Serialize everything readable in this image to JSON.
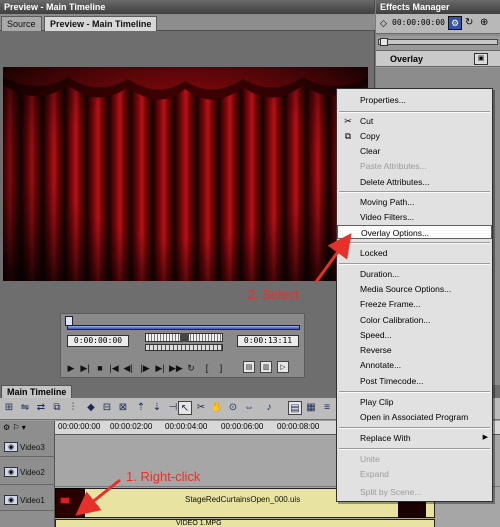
{
  "preview_panel": {
    "title": "Preview - Main Timeline",
    "tabs": [
      {
        "label": "Source"
      },
      {
        "label": "Preview - Main Timeline"
      }
    ],
    "timecode_in": "0:00:00:00",
    "timecode_out": "0:00:13:11",
    "position_fraction": 0.0
  },
  "effects_panel": {
    "title": "Effects Manager",
    "timecode": "00:00:00:00",
    "selected_effect": "Overlay"
  },
  "timeline": {
    "tab_label": "Main Timeline",
    "ruler_ticks": [
      "00:00:00:00",
      "00:00:02:00",
      "00:00:04:00",
      "00:00:06:00",
      "00:00:08:00"
    ],
    "tracks": [
      {
        "name": "Video3"
      },
      {
        "name": "Video2"
      },
      {
        "name": "Video1"
      }
    ],
    "clips": {
      "video2": "StageRedCurtainsOpen_000.uis",
      "video1": "VIDEO 1.MPG"
    }
  },
  "context_menu": {
    "items": [
      {
        "label": "Properties...",
        "enabled": true
      },
      {
        "label": "Cut",
        "enabled": true,
        "icon": "scissors-icon"
      },
      {
        "label": "Copy",
        "enabled": true,
        "icon": "copy-icon"
      },
      {
        "label": "Clear",
        "enabled": true
      },
      {
        "label": "Paste Attributes...",
        "enabled": false
      },
      {
        "label": "Delete Attributes...",
        "enabled": true
      },
      {
        "label": "Moving Path...",
        "enabled": true
      },
      {
        "label": "Video Filters...",
        "enabled": true
      },
      {
        "label": "Overlay Options...",
        "enabled": true,
        "highlighted": true
      },
      {
        "label": "Locked",
        "enabled": true
      },
      {
        "label": "Duration...",
        "enabled": true
      },
      {
        "label": "Media Source Options...",
        "enabled": true
      },
      {
        "label": "Freeze Frame...",
        "enabled": true
      },
      {
        "label": "Color Calibration...",
        "enabled": true
      },
      {
        "label": "Speed...",
        "enabled": true
      },
      {
        "label": "Reverse",
        "enabled": true
      },
      {
        "label": "Annotate...",
        "enabled": true
      },
      {
        "label": "Post Timecode...",
        "enabled": true
      },
      {
        "label": "Play Clip",
        "enabled": true
      },
      {
        "label": "Open in Associated Program",
        "enabled": true
      },
      {
        "label": "Replace With",
        "enabled": true,
        "submenu": true
      },
      {
        "label": "Unite",
        "enabled": false
      },
      {
        "label": "Expand",
        "enabled": false
      },
      {
        "label": "Split by Scene...",
        "enabled": false
      }
    ]
  },
  "annotations": {
    "step1": "1. Right-click",
    "step2": "2. Select",
    "color": "#e8302a"
  }
}
